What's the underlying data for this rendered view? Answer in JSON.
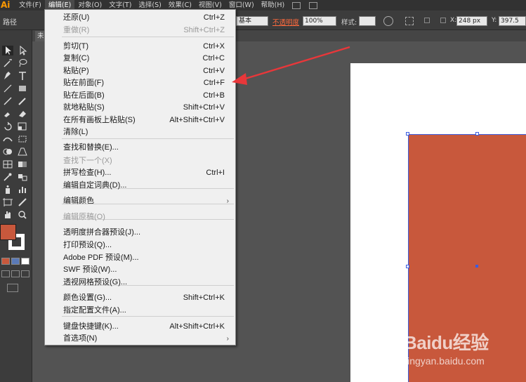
{
  "app": {
    "logo": "Ai"
  },
  "menubar": {
    "items": [
      "文件(F)",
      "编辑(E)",
      "对象(O)",
      "文字(T)",
      "选择(S)",
      "效果(C)",
      "视图(V)",
      "窗口(W)",
      "帮助(H)"
    ]
  },
  "controlbar": {
    "object_label": "路径",
    "stroke_style": "基本",
    "opacity_label": "不透明度",
    "opacity_value": "100%",
    "style_label": "样式:",
    "x_label": "X:",
    "x_value": "248 px",
    "y_label": "Y:",
    "y_value": "397.5"
  },
  "document": {
    "tab_label": "未"
  },
  "edit_menu": {
    "items": [
      {
        "label": "还原(U)",
        "shortcut": "Ctrl+Z",
        "disabled": false
      },
      {
        "label": "重做(R)",
        "shortcut": "Shift+Ctrl+Z",
        "disabled": true
      },
      {
        "label": "剪切(T)",
        "shortcut": "Ctrl+X",
        "disabled": false
      },
      {
        "label": "复制(C)",
        "shortcut": "Ctrl+C",
        "disabled": false
      },
      {
        "label": "粘贴(P)",
        "shortcut": "Ctrl+V",
        "disabled": false
      },
      {
        "label": "贴在前面(F)",
        "shortcut": "Ctrl+F",
        "disabled": false
      },
      {
        "label": "贴在后面(B)",
        "shortcut": "Ctrl+B",
        "disabled": false
      },
      {
        "label": "就地粘贴(S)",
        "shortcut": "Shift+Ctrl+V",
        "disabled": false
      },
      {
        "label": "在所有画板上粘贴(S)",
        "shortcut": "Alt+Shift+Ctrl+V",
        "disabled": false
      },
      {
        "label": "清除(L)",
        "shortcut": "",
        "disabled": false
      },
      {
        "label": "查找和替换(E)...",
        "shortcut": "",
        "disabled": false
      },
      {
        "label": "查找下一个(X)",
        "shortcut": "",
        "disabled": true
      },
      {
        "label": "拼写检查(H)...",
        "shortcut": "Ctrl+I",
        "disabled": false
      },
      {
        "label": "编辑自定词典(D)...",
        "shortcut": "",
        "disabled": false
      },
      {
        "label": "编辑颜色",
        "shortcut": "",
        "disabled": false,
        "submenu": true
      },
      {
        "label": "编辑原稿(O)",
        "shortcut": "",
        "disabled": true
      },
      {
        "label": "透明度拼合器预设(J)...",
        "shortcut": "",
        "disabled": false
      },
      {
        "label": "打印预设(Q)...",
        "shortcut": "",
        "disabled": false
      },
      {
        "label": "Adobe PDF 预设(M)...",
        "shortcut": "",
        "disabled": false
      },
      {
        "label": "SWF 预设(W)...",
        "shortcut": "",
        "disabled": false
      },
      {
        "label": "透视网格预设(G)...",
        "shortcut": "",
        "disabled": false
      },
      {
        "label": "颜色设置(G)...",
        "shortcut": "Shift+Ctrl+K",
        "disabled": false
      },
      {
        "label": "指定配置文件(A)...",
        "shortcut": "",
        "disabled": false
      },
      {
        "label": "键盘快捷键(K)...",
        "shortcut": "Alt+Shift+Ctrl+K",
        "disabled": false
      },
      {
        "label": "首选项(N)",
        "shortcut": "",
        "disabled": false,
        "submenu": true
      }
    ],
    "submenu_glyph": "›"
  },
  "watermark": {
    "title": "Baidu经验",
    "url": "jingyan.baidu.com"
  },
  "colors": {
    "fill": "#c8583c",
    "selection": "#3b5de0",
    "arrow": "#e8373a",
    "opacity_label": "#ff6a3d"
  }
}
